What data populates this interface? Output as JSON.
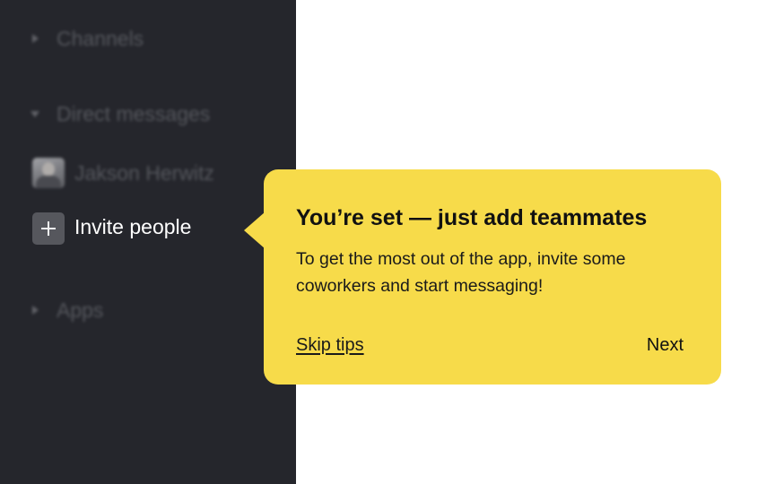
{
  "sidebar": {
    "sections": {
      "channels": {
        "label": "Channels",
        "expanded": false
      },
      "direct_messages": {
        "label": "Direct messages",
        "expanded": true
      },
      "apps": {
        "label": "Apps",
        "expanded": false
      }
    },
    "direct_messages": [
      {
        "name": "Jakson Herwitz"
      }
    ],
    "invite": {
      "label": "Invite people",
      "icon": "plus-icon"
    }
  },
  "tooltip": {
    "title": "You’re set — just add teammates",
    "body": "To get the most out of the app, invite some coworkers and start messaging!",
    "skip_label": "Skip tips",
    "next_label": "Next",
    "background_color": "#f7db4a"
  },
  "colors": {
    "sidebar_bg": "#25262c",
    "main_bg": "#ffffff",
    "accent_yellow": "#f7db4a"
  }
}
